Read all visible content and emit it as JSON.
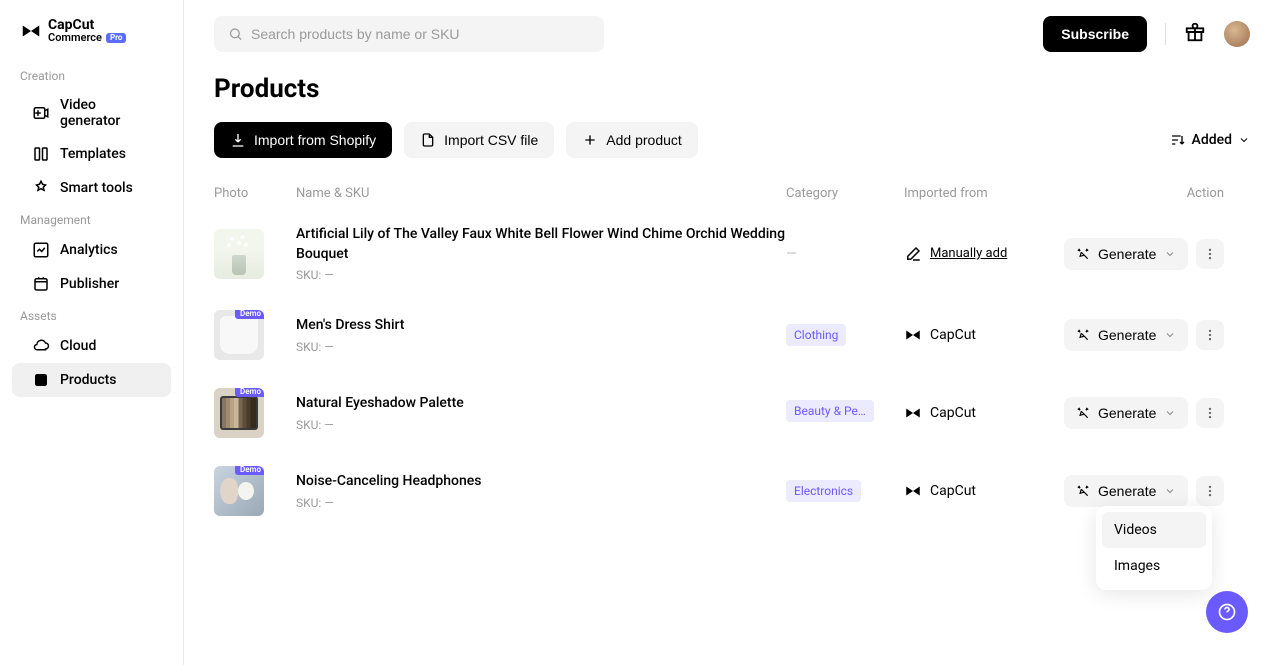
{
  "logo": {
    "main": "CapCut",
    "sub": "Commerce",
    "tag": "Pro"
  },
  "sidebar": {
    "sections": [
      {
        "label": "Creation",
        "items": [
          {
            "label": "Video generator",
            "icon": "video-gen"
          },
          {
            "label": "Templates",
            "icon": "templates"
          },
          {
            "label": "Smart tools",
            "icon": "smart-tools"
          }
        ]
      },
      {
        "label": "Management",
        "items": [
          {
            "label": "Analytics",
            "icon": "analytics"
          },
          {
            "label": "Publisher",
            "icon": "publisher"
          }
        ]
      },
      {
        "label": "Assets",
        "items": [
          {
            "label": "Cloud",
            "icon": "cloud"
          },
          {
            "label": "Products",
            "icon": "products",
            "active": true
          }
        ]
      }
    ]
  },
  "search": {
    "placeholder": "Search products by name or SKU"
  },
  "topbar": {
    "subscribe": "Subscribe"
  },
  "page": {
    "title": "Products"
  },
  "toolbar": {
    "import_shopify": "Import from Shopify",
    "import_csv": "Import CSV file",
    "add_product": "Add product",
    "sort_label": "Added"
  },
  "columns": {
    "photo": "Photo",
    "name": "Name & SKU",
    "category": "Category",
    "imported": "Imported from",
    "action": "Action"
  },
  "rows": [
    {
      "name": "Artificial Lily of The Valley Faux White Bell Flower Wind Chime Orchid Wedding Bouquet",
      "sku_label": "SKU: —",
      "category": "—",
      "category_class": "none",
      "imported": "Manually add",
      "imported_type": "manual",
      "demo": false,
      "generate": "Generate"
    },
    {
      "name": "Men's Dress Shirt",
      "sku_label": "SKU: —",
      "category": "Clothing",
      "category_class": "clothing",
      "imported": "CapCut",
      "imported_type": "capcut",
      "demo": true,
      "generate": "Generate"
    },
    {
      "name": "Natural Eyeshadow Palette",
      "sku_label": "SKU: —",
      "category": "Beauty & Perso...",
      "category_class": "beauty",
      "imported": "CapCut",
      "imported_type": "capcut",
      "demo": true,
      "generate": "Generate"
    },
    {
      "name": "Noise-Canceling Headphones",
      "sku_label": "SKU: —",
      "category": "Electronics",
      "category_class": "electronics",
      "imported": "CapCut",
      "imported_type": "capcut",
      "demo": true,
      "generate": "Generate",
      "dropdown_open": true
    }
  ],
  "dropdown": {
    "videos": "Videos",
    "images": "Images"
  },
  "demo_badge": "Demo"
}
